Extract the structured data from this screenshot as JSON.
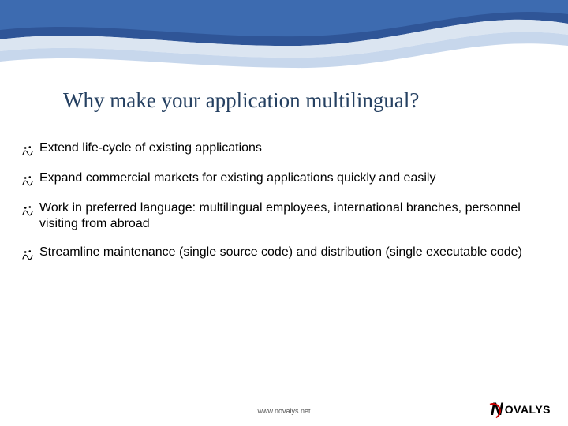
{
  "title": "Why make your application multilingual?",
  "bullets": [
    "Extend life-cycle of existing applications",
    "Expand commercial markets for existing applications quickly and easily",
    "Work in preferred language: multilingual employees, international branches, personnel visiting from abroad",
    "Streamline maintenance (single source code) and distribution (single executable code)"
  ],
  "footer_url": "www.novalys.net",
  "logo": {
    "n": "N",
    "text": "OVALYS"
  }
}
